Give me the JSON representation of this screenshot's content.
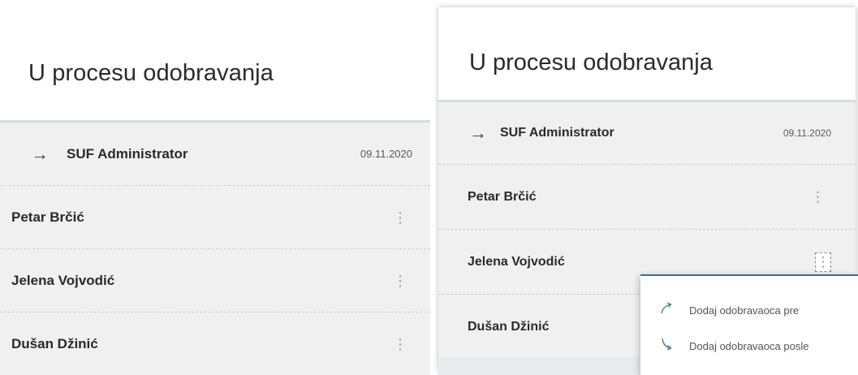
{
  "left_panel": {
    "title": "U procesu odobravanja",
    "rows": [
      {
        "name": "SUF Administrator",
        "date": "09.11.2020",
        "current": true
      },
      {
        "name": "Petar Brčić"
      },
      {
        "name": "Jelena Vojvodić"
      },
      {
        "name": "Dušan Džinić"
      }
    ]
  },
  "right_panel": {
    "title": "U procesu odobravanja",
    "rows": [
      {
        "name": "SUF Administrator",
        "date": "09.11.2020",
        "current": true
      },
      {
        "name": "Petar Brčić"
      },
      {
        "name": "Jelena Vojvodić",
        "menu_open": true
      },
      {
        "name": "Dušan Džinić"
      }
    ]
  },
  "context_menu": {
    "items": [
      {
        "label": "Dodaj odobravaoca pre",
        "icon": "arrow-up-right-icon"
      },
      {
        "label": "Dodaj odobravaoca posle",
        "icon": "arrow-down-right-icon"
      }
    ],
    "accent": "#3f6f86",
    "icon_color": "#4a7f98"
  },
  "icons": {
    "current_arrow": "→",
    "kebab": "⋮"
  }
}
